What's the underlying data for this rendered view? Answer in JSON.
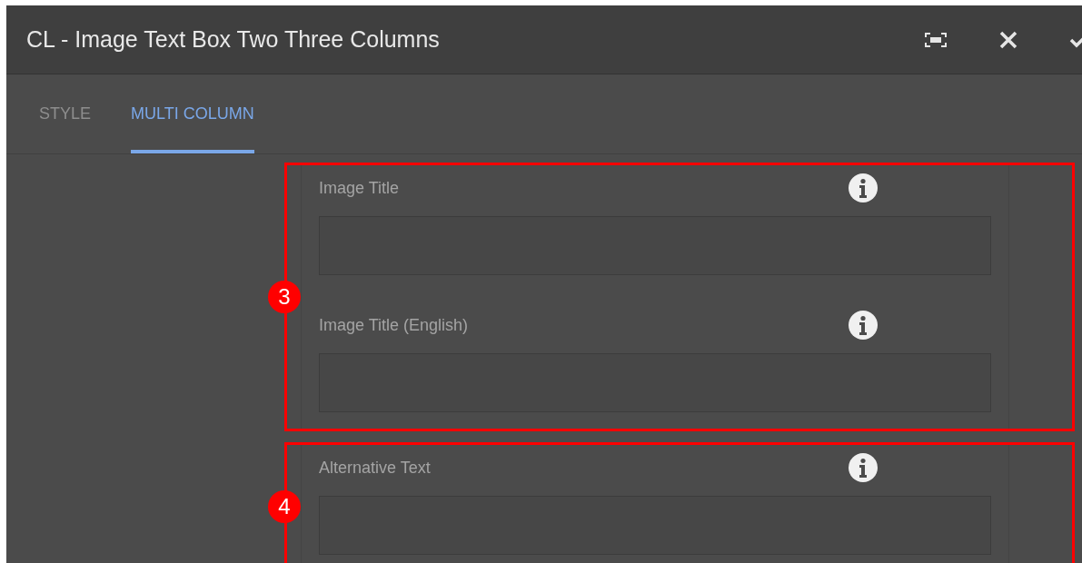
{
  "window": {
    "title": "CL - Image Text Box Two Three Columns"
  },
  "tabs": [
    {
      "label": "STYLE",
      "selected": false
    },
    {
      "label": "MULTI COLUMN",
      "selected": true
    }
  ],
  "callouts": [
    {
      "number": "3",
      "fields": [
        {
          "label": "Image Title"
        },
        {
          "label": "Image Title (English)"
        }
      ]
    },
    {
      "number": "4",
      "fields": [
        {
          "label": "Alternative Text"
        }
      ]
    }
  ]
}
